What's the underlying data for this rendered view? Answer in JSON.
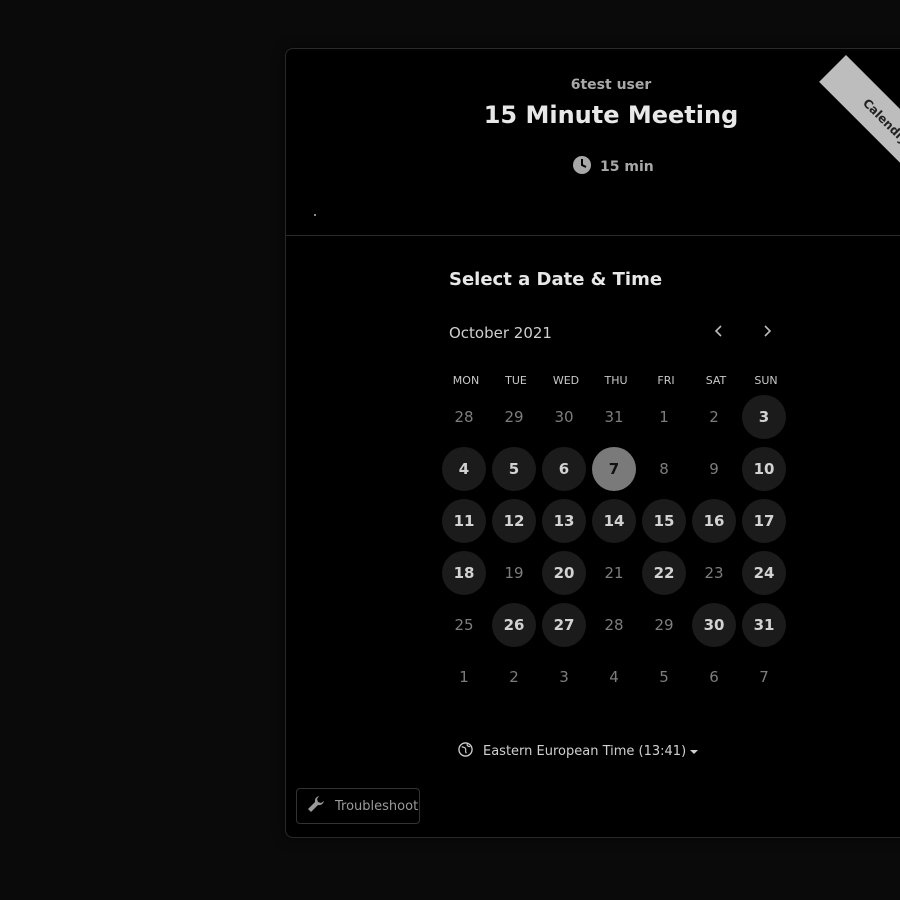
{
  "header": {
    "host": "6test user",
    "title": "15 Minute Meeting",
    "duration": "15 min"
  },
  "ribbon": {
    "text": "Calendly"
  },
  "calendar": {
    "section_title": "Select a Date & Time",
    "month": "October 2021",
    "weekdays": [
      "MON",
      "TUE",
      "WED",
      "THU",
      "FRI",
      "SAT",
      "SUN"
    ],
    "days": [
      {
        "d": "28",
        "state": "out"
      },
      {
        "d": "29",
        "state": "out"
      },
      {
        "d": "30",
        "state": "out"
      },
      {
        "d": "31",
        "state": "out"
      },
      {
        "d": "1",
        "state": "off"
      },
      {
        "d": "2",
        "state": "off"
      },
      {
        "d": "3",
        "state": "available"
      },
      {
        "d": "4",
        "state": "available"
      },
      {
        "d": "5",
        "state": "available"
      },
      {
        "d": "6",
        "state": "available"
      },
      {
        "d": "7",
        "state": "selected"
      },
      {
        "d": "8",
        "state": "off"
      },
      {
        "d": "9",
        "state": "off"
      },
      {
        "d": "10",
        "state": "available"
      },
      {
        "d": "11",
        "state": "available"
      },
      {
        "d": "12",
        "state": "available"
      },
      {
        "d": "13",
        "state": "available"
      },
      {
        "d": "14",
        "state": "available"
      },
      {
        "d": "15",
        "state": "available"
      },
      {
        "d": "16",
        "state": "available"
      },
      {
        "d": "17",
        "state": "available"
      },
      {
        "d": "18",
        "state": "available"
      },
      {
        "d": "19",
        "state": "off"
      },
      {
        "d": "20",
        "state": "available"
      },
      {
        "d": "21",
        "state": "off"
      },
      {
        "d": "22",
        "state": "available"
      },
      {
        "d": "23",
        "state": "off"
      },
      {
        "d": "24",
        "state": "available"
      },
      {
        "d": "25",
        "state": "off"
      },
      {
        "d": "26",
        "state": "available"
      },
      {
        "d": "27",
        "state": "available"
      },
      {
        "d": "28",
        "state": "off"
      },
      {
        "d": "29",
        "state": "off"
      },
      {
        "d": "30",
        "state": "available"
      },
      {
        "d": "31",
        "state": "available"
      },
      {
        "d": "1",
        "state": "out"
      },
      {
        "d": "2",
        "state": "out"
      },
      {
        "d": "3",
        "state": "out"
      },
      {
        "d": "4",
        "state": "out"
      },
      {
        "d": "5",
        "state": "out"
      },
      {
        "d": "6",
        "state": "out"
      },
      {
        "d": "7",
        "state": "out"
      }
    ]
  },
  "timezone": {
    "label": "Eastern European Time (13:41)"
  },
  "troubleshoot": {
    "label": "Troubleshoot"
  },
  "colors": {
    "background": "#000000",
    "selected": "#7a7a7a",
    "available_bg": "#1b1b1b"
  }
}
